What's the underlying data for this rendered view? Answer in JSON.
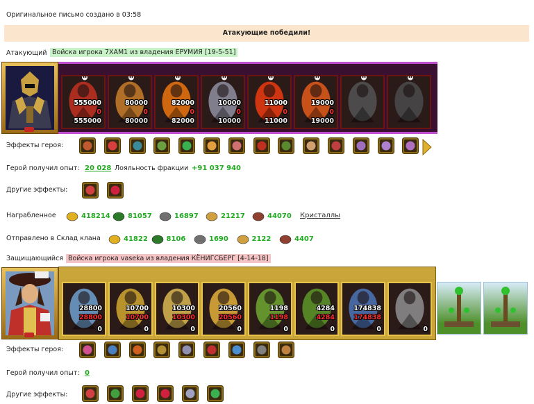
{
  "letter_info": "Оригинальное письмо создано в 03:58",
  "banner": "Атакующие победили!",
  "attacker": {
    "label": "Атакующий",
    "name": "Войска игрока 7XAM1 из владения ЕРУМИЯ [19-5-51]",
    "units": [
      {
        "name": "red-demon",
        "top": "555000",
        "lost": "0",
        "bottom": "555000",
        "color": "#b83020"
      },
      {
        "name": "lich-sorcerer",
        "top": "80000",
        "lost": "0",
        "bottom": "80000",
        "color": "#c07828"
      },
      {
        "name": "fire-demon",
        "top": "82000",
        "lost": "0",
        "bottom": "82000",
        "color": "#e07010"
      },
      {
        "name": "stone-dragon",
        "top": "10000",
        "lost": "0",
        "bottom": "10000",
        "color": "#8a8a9a"
      },
      {
        "name": "flame-elemental",
        "top": "11000",
        "lost": "0",
        "bottom": "11000",
        "color": "#e03810"
      },
      {
        "name": "fire-giant",
        "top": "19000",
        "lost": "0",
        "bottom": "19000",
        "color": "#d85818"
      },
      {
        "name": "shadow-beast",
        "top": "",
        "lost": "",
        "bottom": "",
        "color": "#505050"
      },
      {
        "name": "dark-reaper",
        "top": "",
        "lost": "",
        "bottom": "",
        "color": "#484848"
      }
    ],
    "hero_effects_label": "Эффекты героя:",
    "hero_effects": [
      {
        "icon": "armored-fist-icon",
        "color": "#c05a30"
      },
      {
        "icon": "dice-icon",
        "color": "#d84040"
      },
      {
        "icon": "shield-icon",
        "color": "#3a8a9a"
      },
      {
        "icon": "gauntlet-icon",
        "color": "#6aa040"
      },
      {
        "icon": "sword-icon",
        "color": "#3ab050"
      },
      {
        "icon": "handshake-icon",
        "color": "#e0a040"
      },
      {
        "icon": "open-hand-icon",
        "color": "#d07070"
      },
      {
        "icon": "xp-icon",
        "color": "#c03020"
      },
      {
        "icon": "xp-tree-icon",
        "color": "#5a8a30"
      },
      {
        "icon": "horn-icon",
        "color": "#d0a070"
      },
      {
        "icon": "chest-icon",
        "color": "#c04040"
      },
      {
        "icon": "claw-icon",
        "color": "#a070c0"
      },
      {
        "icon": "ring-icon",
        "color": "#b080d0"
      },
      {
        "icon": "scroll-icon",
        "color": "#b070c0"
      }
    ],
    "xp_label": "Герой получил опыт:",
    "xp_value": "20 028",
    "loyalty_label": "Лояльность фракции",
    "loyalty_value": "+91 037 940",
    "other_effects_label": "Другие эффекты:",
    "other_effects": [
      {
        "icon": "sword-heart-icon",
        "color": "#d04040"
      },
      {
        "icon": "hearts-icon",
        "color": "#d02040"
      }
    ],
    "reward_label": "Награбленное",
    "rewards": [
      {
        "icon": "gold-icon",
        "value": "418214",
        "color": "#e0b020"
      },
      {
        "icon": "wood-icon",
        "value": "81057",
        "color": "#2a7a2a"
      },
      {
        "icon": "ore-icon",
        "value": "16897",
        "color": "#707070"
      },
      {
        "icon": "wheat-icon",
        "value": "21217",
        "color": "#d0a040"
      },
      {
        "icon": "mercury-icon",
        "value": "44070",
        "color": "#904030"
      }
    ],
    "crystals_link": "Кристаллы",
    "clan_label": "Отправлено в Склад клана",
    "clan": [
      {
        "icon": "gold-icon",
        "value": "41822",
        "color": "#e0b020"
      },
      {
        "icon": "wood-icon",
        "value": "8106",
        "color": "#2a7a2a"
      },
      {
        "icon": "ore-icon",
        "value": "1690",
        "color": "#707070"
      },
      {
        "icon": "wheat-icon",
        "value": "2122",
        "color": "#d0a040"
      },
      {
        "icon": "mercury-icon",
        "value": "4407",
        "color": "#904030"
      }
    ]
  },
  "defender": {
    "label": "Защищающийся",
    "name": "Войска игрока vaseka из владения КЁНИГСБЕРГ [4-14-18]",
    "units": [
      {
        "name": "castle-walls",
        "top": "28800",
        "lost": "28800",
        "remain": "0",
        "color": "#6a9ac8"
      },
      {
        "name": "griffin-knight",
        "top": "10700",
        "lost": "10700",
        "remain": "0",
        "color": "#c8a030"
      },
      {
        "name": "paladin",
        "top": "10300",
        "lost": "10300",
        "remain": "0",
        "color": "#d0b050"
      },
      {
        "name": "golden-griffin",
        "top": "20560",
        "lost": "20560",
        "remain": "0",
        "color": "#d8a838"
      },
      {
        "name": "elf-archer",
        "top": "1198",
        "lost": "1198",
        "remain": "0",
        "color": "#6aa030"
      },
      {
        "name": "druid",
        "top": "4284",
        "lost": "4284",
        "remain": "0",
        "color": "#5a9028"
      },
      {
        "name": "crusader",
        "top": "174838",
        "lost": "174838",
        "remain": "0",
        "color": "#4a70b0"
      },
      {
        "name": "ghost-knight",
        "top": "",
        "lost": "",
        "remain": "0",
        "color": "#888888"
      }
    ],
    "towers": [
      {
        "name": "mage-tower"
      },
      {
        "name": "mage-tower"
      }
    ],
    "hero_effects_label": "Эффекты героя:",
    "hero_effects": [
      {
        "icon": "castle-icon",
        "color": "#d05090"
      },
      {
        "icon": "knight-icon",
        "color": "#4a80c0"
      },
      {
        "icon": "fire-shield-icon",
        "color": "#d06020"
      },
      {
        "icon": "crown-icon",
        "color": "#b09030"
      },
      {
        "icon": "wings-icon",
        "color": "#9090b0"
      },
      {
        "icon": "lion-icon",
        "color": "#c03030"
      },
      {
        "icon": "horse-icon",
        "color": "#4a90d0"
      },
      {
        "icon": "blade-icon",
        "color": "#808080"
      },
      {
        "icon": "round-shield-icon",
        "color": "#c08040"
      }
    ],
    "xp_label": "Герой получил опыт:",
    "xp_value": "0",
    "other_effects_label": "Другие эффекты:",
    "other_effects": [
      {
        "icon": "sword-heart-icon",
        "color": "#d04040"
      },
      {
        "icon": "arrow-icon",
        "color": "#40a040"
      },
      {
        "icon": "heart-icon",
        "color": "#d02040"
      },
      {
        "icon": "heart-icon",
        "color": "#d02040"
      },
      {
        "icon": "blade-icon",
        "color": "#a0a0c0"
      },
      {
        "icon": "sword-icon",
        "color": "#3ab050"
      }
    ]
  }
}
